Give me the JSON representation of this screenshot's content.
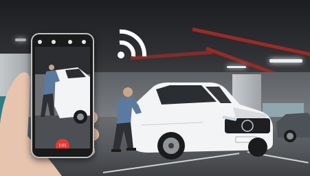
{
  "phone": {
    "record_label": "1:01",
    "record_color": "#e53935",
    "icons": [
      "settings-icon",
      "timer-icon",
      "flash-icon",
      "mic-icon"
    ]
  },
  "colors": {
    "beam": "#9b2a25",
    "teal_wall": "#2f7c86",
    "wifi": "#ffffff",
    "car": "#f4f5f6"
  },
  "wifi_icon": "wifi-icon"
}
